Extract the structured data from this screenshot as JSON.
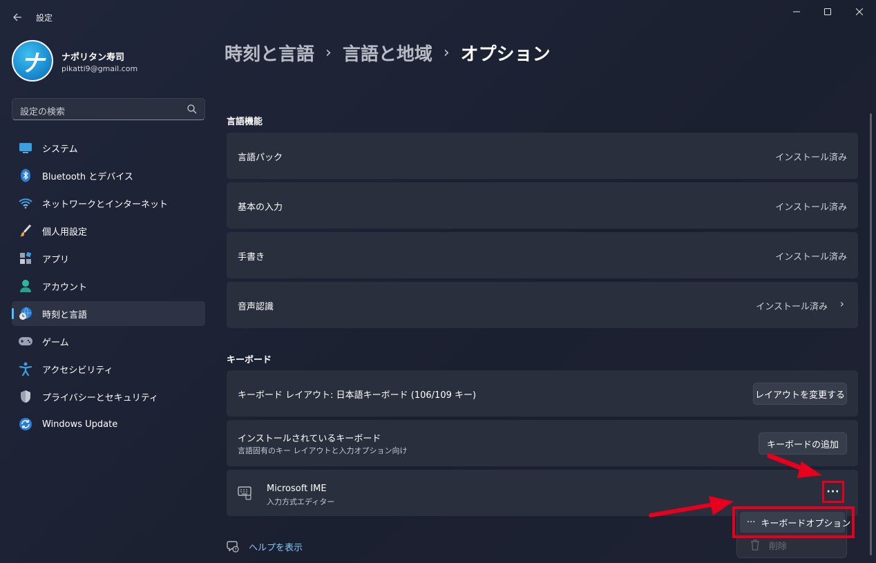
{
  "app": {
    "title": "設定",
    "back_icon": "arrow-left-icon",
    "controls": [
      "minimize-icon",
      "maximize-icon",
      "close-icon"
    ]
  },
  "profile": {
    "name": "ナポリタン寿司",
    "email": "pikatti9@gmail.com",
    "avatar_glyph": "ナ"
  },
  "search": {
    "placeholder": "設定の検索"
  },
  "sidebar": {
    "items": [
      {
        "label": "システム",
        "icon": "system-icon"
      },
      {
        "label": "Bluetooth とデバイス",
        "icon": "bluetooth-icon"
      },
      {
        "label": "ネットワークとインターネット",
        "icon": "wifi-icon"
      },
      {
        "label": "個人用設定",
        "icon": "brush-icon"
      },
      {
        "label": "アプリ",
        "icon": "apps-icon"
      },
      {
        "label": "アカウント",
        "icon": "account-icon"
      },
      {
        "label": "時刻と言語",
        "icon": "time-language-icon",
        "active": true
      },
      {
        "label": "ゲーム",
        "icon": "gamepad-icon"
      },
      {
        "label": "アクセシビリティ",
        "icon": "accessibility-icon"
      },
      {
        "label": "プライバシーとセキュリティ",
        "icon": "shield-icon"
      },
      {
        "label": "Windows Update",
        "icon": "update-icon"
      }
    ]
  },
  "breadcrumb": {
    "part1": "時刻と言語",
    "part2": "言語と地域",
    "current": "オプション",
    "separator": "›"
  },
  "language_features": {
    "title": "言語機能",
    "rows": [
      {
        "label": "言語パック",
        "status": "インストール済み"
      },
      {
        "label": "基本の入力",
        "status": "インストール済み"
      },
      {
        "label": "手書き",
        "status": "インストール済み"
      },
      {
        "label": "音声認識",
        "status": "インストール済み",
        "chevron": "›"
      }
    ]
  },
  "keyboard": {
    "title": "キーボード",
    "layout_label": "キーボード レイアウト: 日本語キーボード (106/109 キー)",
    "layout_button": "レイアウトを変更する",
    "installed_label": "インストールされているキーボード",
    "installed_sub": "言語固有のキー レイアウトと入力オプション向け",
    "add_button": "キーボードの追加",
    "ime_name": "Microsoft IME",
    "ime_sub": "入力方式エディター",
    "more_glyph": "···"
  },
  "context_menu": {
    "items": [
      {
        "label": "キーボードオプション",
        "icon": "more-dots-icon",
        "glyph": "···",
        "enabled": true
      },
      {
        "label": "削除",
        "icon": "trash-icon",
        "enabled": false
      }
    ]
  },
  "help": {
    "label": "ヘルプを表示"
  },
  "colors": {
    "accent": "#4cc2ff",
    "annotation_red": "#e6001e",
    "link": "#7fc8f5"
  }
}
